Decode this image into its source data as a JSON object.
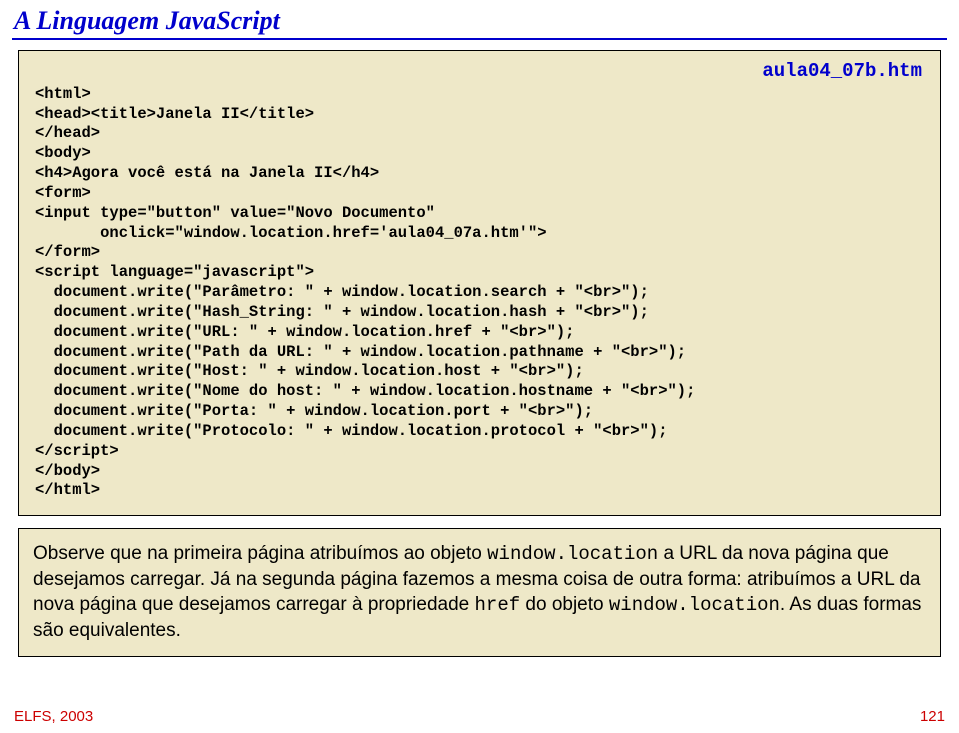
{
  "page": {
    "title": "A Linguagem JavaScript",
    "filelabel": "aula04_07b.htm"
  },
  "code": {
    "l1": "<html>",
    "l2": "<head><title>Janela II</title>",
    "l3": "</head>",
    "l4": "<body>",
    "l5": "<h4>Agora você está na Janela II</h4>",
    "l6": "<form>",
    "l7": "<input type=\"button\" value=\"Novo Documento\"",
    "l8": "       onclick=\"window.location.href='aula04_07a.htm'\">",
    "l9": "</form>",
    "l10": "<script language=\"javascript\">",
    "l11": "  document.write(\"Parâmetro: \" + window.location.search + \"<br>\");",
    "l12": "  document.write(\"Hash_String: \" + window.location.hash + \"<br>\");",
    "l13": "  document.write(\"URL: \" + window.location.href + \"<br>\");",
    "l14": "  document.write(\"Path da URL: \" + window.location.pathname + \"<br>\");",
    "l15": "  document.write(\"Host: \" + window.location.host + \"<br>\");",
    "l16": "  document.write(\"Nome do host: \" + window.location.hostname + \"<br>\");",
    "l17": "  document.write(\"Porta: \" + window.location.port + \"<br>\");",
    "l18": "  document.write(\"Protocolo: \" + window.location.protocol + \"<br>\");",
    "l19": "</script>",
    "l20": "</body>",
    "l21": "</html>"
  },
  "note": {
    "t1": "Observe que na primeira página atribuímos ao objeto ",
    "m1": "window.location",
    "t2": " a URL da nova página que desejamos carregar. Já na segunda página fazemos a mesma coisa de outra forma: atribuímos a URL da nova página que desejamos carregar à propriedade ",
    "m2": "href",
    "t3": " do objeto ",
    "m3": "window.location",
    "t4": ". As duas formas são equivalentes."
  },
  "footer": {
    "left": "ELFS, 2003",
    "page": "121"
  }
}
